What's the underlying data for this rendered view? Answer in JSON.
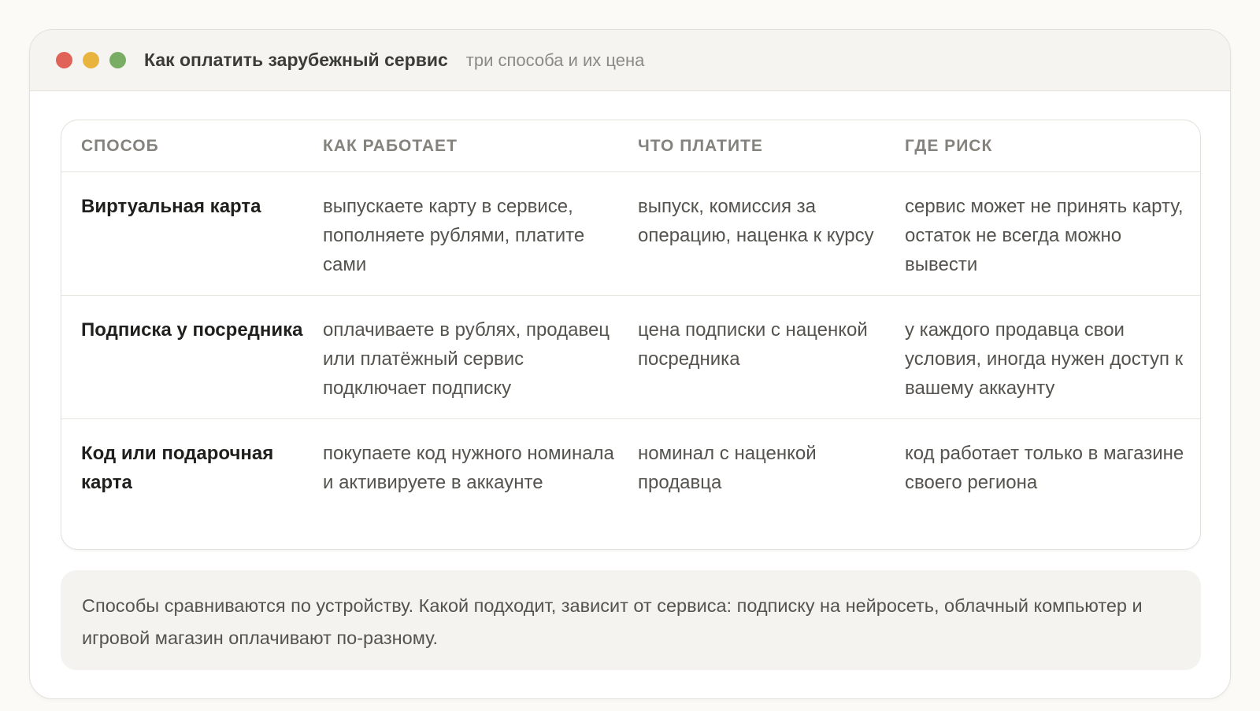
{
  "window": {
    "title": "Как оплатить зарубежный сервис",
    "subtitle": "три способа и их цена",
    "controls": {
      "close_color": "#e06259",
      "minimize_color": "#e8b43e",
      "maximize_color": "#79ad63"
    }
  },
  "table": {
    "headers": [
      "СПОСОБ",
      "КАК РАБОТАЕТ",
      "ЧТО ПЛАТИТЕ",
      "ГДЕ РИСК"
    ],
    "rows": [
      {
        "method": "Виртуальная карта",
        "how": "выпускаете карту в сервисе, пополняете рублями, платите сами",
        "cost": "выпуск, комиссия за операцию, наценка к курсу",
        "risk": "сервис может не принять карту, остаток не всегда можно вывести"
      },
      {
        "method": "Подписка у посредника",
        "how": "оплачиваете в рублях, продавец или платёжный сервис подключает подписку",
        "cost": "цена подписки с наценкой посредника",
        "risk": "у каждого продавца свои условия, иногда нужен доступ к вашему аккаунту"
      },
      {
        "method": "Код или подарочная карта",
        "how": "покупаете код нужного номинала и активируете в аккаунте",
        "cost": "номинал с наценкой продавца",
        "risk": "код работает только в магазине своего региона"
      }
    ]
  },
  "note": "Способы сравниваются по устройству. Какой подходит, зависит от сервиса: подписку на нейросеть, облачный компьютер и игровой магазин оплачивают по-разному."
}
